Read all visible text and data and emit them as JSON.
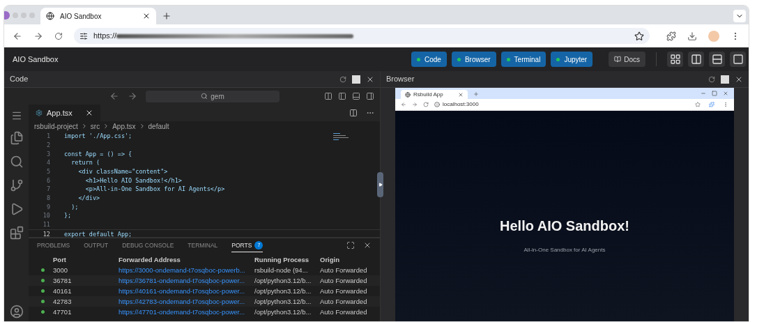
{
  "browser_tab": {
    "title": "AIO Sandbox"
  },
  "address_bar": {
    "url": "https://"
  },
  "app": {
    "title": "AIO Sandbox",
    "service_buttons": [
      {
        "label": "Code"
      },
      {
        "label": "Browser"
      },
      {
        "label": "Terminal"
      },
      {
        "label": "Jupyter"
      }
    ],
    "docs_button": "Docs",
    "layouts": [
      {
        "kind": "grid",
        "selected": false
      },
      {
        "kind": "columns",
        "selected": false
      },
      {
        "kind": "rows",
        "selected": false
      },
      {
        "kind": "single",
        "selected": false
      }
    ]
  },
  "code_panel": {
    "title": "Code",
    "command_search": "gem",
    "editor_tab": "App.tsx",
    "breadcrumb": [
      "rsbuild-project",
      "src",
      "App.tsx",
      "default"
    ],
    "lines": [
      {
        "number": "1",
        "text": "import './App.css';"
      },
      {
        "number": "2"
      },
      {
        "number": "3",
        "text": "const App = () => {"
      },
      {
        "number": "4",
        "text": "  return ("
      },
      {
        "number": "5",
        "text": "    <div className=\"content\">"
      },
      {
        "number": "6",
        "text": "      <h1>Hello AIO Sandbox!</h1>"
      },
      {
        "number": "7",
        "text": "      <p>All-in-One Sandbox for AI Agents</p>"
      },
      {
        "number": "8",
        "text": "    </div>"
      },
      {
        "number": "9",
        "text": "  );"
      },
      {
        "number": "10",
        "text": "};"
      },
      {
        "number": "11"
      },
      {
        "number": "12",
        "text": "export default App;"
      }
    ],
    "panel_tabs": [
      {
        "label": "PROBLEMS",
        "selected": false
      },
      {
        "label": "OUTPUT",
        "selected": false
      },
      {
        "label": "DEBUG CONSOLE",
        "selected": false
      },
      {
        "label": "TERMINAL",
        "selected": false
      },
      {
        "label": "PORTS",
        "selected": true,
        "badge": "7"
      }
    ],
    "ports_table": {
      "columns": [
        "Port",
        "Forwarded Address",
        "Running Process",
        "Origin"
      ],
      "rows": [
        {
          "port": "3000",
          "address": "https://3000-ondemand-t7osqboc-powerb...",
          "process": "rsbuild-node (94...",
          "origin": "Auto Forwarded"
        },
        {
          "port": "36781",
          "address": "https://36781-ondemand-t7osqboc-power...",
          "process": "/opt/python3.12/b...",
          "origin": "Auto Forwarded"
        },
        {
          "port": "40161",
          "address": "https://40161-ondemand-t7osqboc-power...",
          "process": "/opt/python3.12/b...",
          "origin": "Auto Forwarded"
        },
        {
          "port": "42783",
          "address": "https://42783-ondemand-t7osqboc-power...",
          "process": "/opt/python3.12/b...",
          "origin": "Auto Forwarded"
        },
        {
          "port": "47701",
          "address": "https://47701-ondemand-t7osqboc-power...",
          "process": "/opt/python3.12/b...",
          "origin": "Auto Forwarded"
        }
      ]
    }
  },
  "browser_panel": {
    "title": "Browser",
    "inner_tab": "Rsbuild App",
    "inner_url": "localhost:3000",
    "heading": "Hello AIO Sandbox!",
    "subtitle": "All-in-One Sandbox for AI Agents"
  }
}
